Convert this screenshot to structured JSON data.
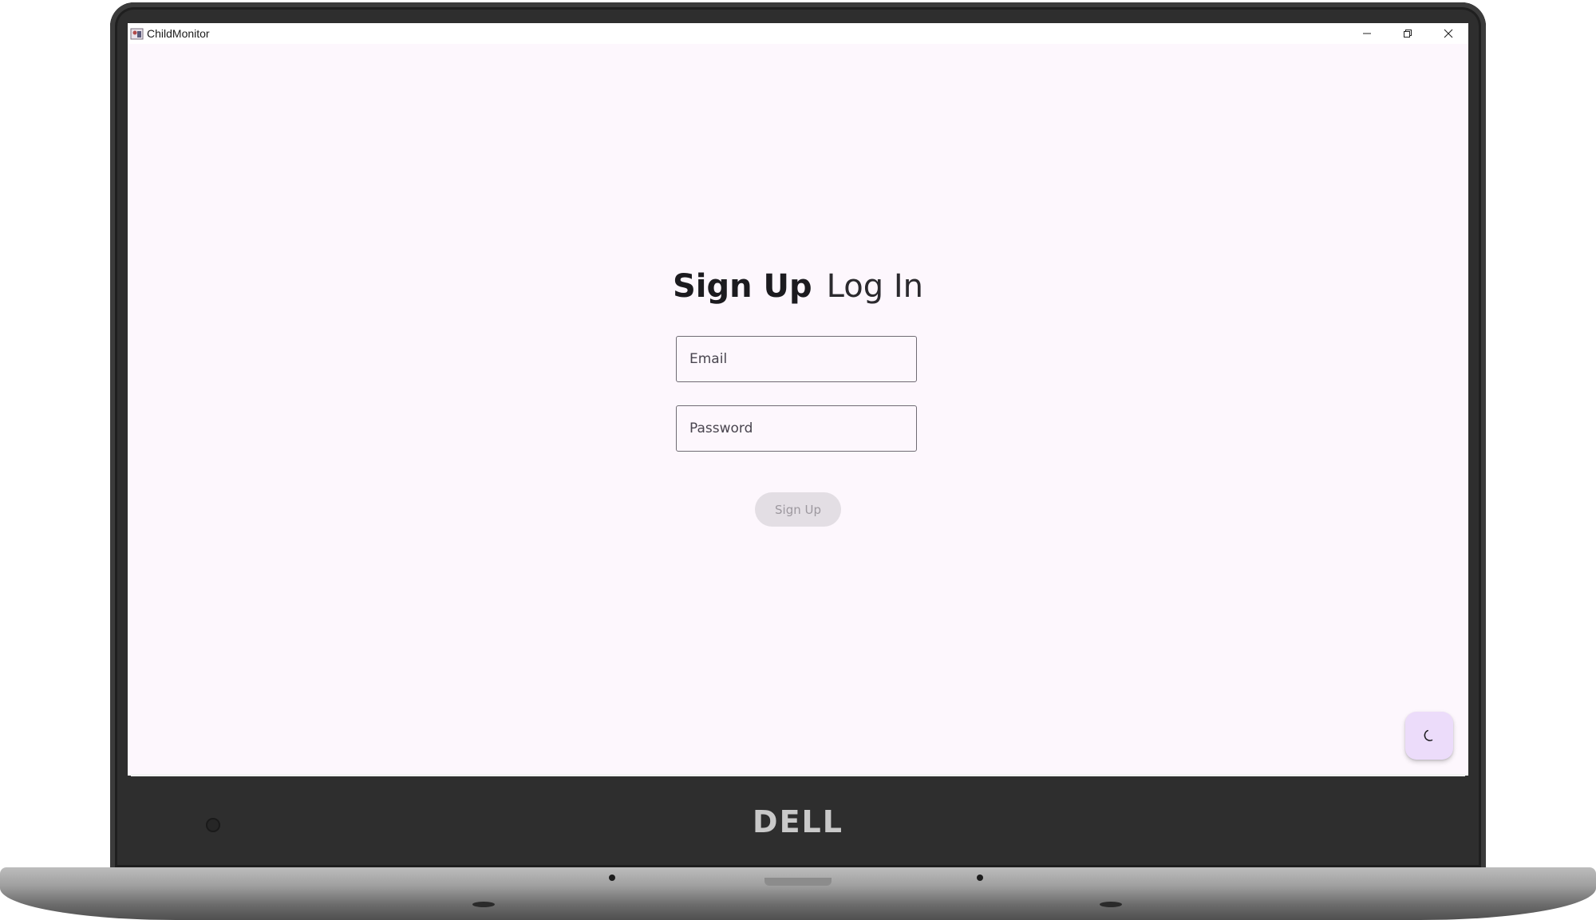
{
  "window": {
    "title": "ChildMonitor",
    "controls": {
      "minimize": "minimize-icon",
      "maximize": "restore-icon",
      "close": "close-icon"
    }
  },
  "auth": {
    "tabs": {
      "signup_label": "Sign Up",
      "login_label": "Log In",
      "active": "Sign Up"
    },
    "email": {
      "placeholder": "Email",
      "value": ""
    },
    "password": {
      "placeholder": "Password",
      "value": ""
    },
    "submit": {
      "label": "Sign Up",
      "enabled": false
    }
  },
  "theme_toggle": {
    "icon": "moon-icon"
  },
  "device": {
    "brand": "DELL"
  },
  "colors": {
    "background": "#fdf7fd",
    "toggle_bg": "#ecdcfa",
    "disabled_button_bg": "#e3dee4",
    "disabled_button_text": "#9d989f"
  }
}
